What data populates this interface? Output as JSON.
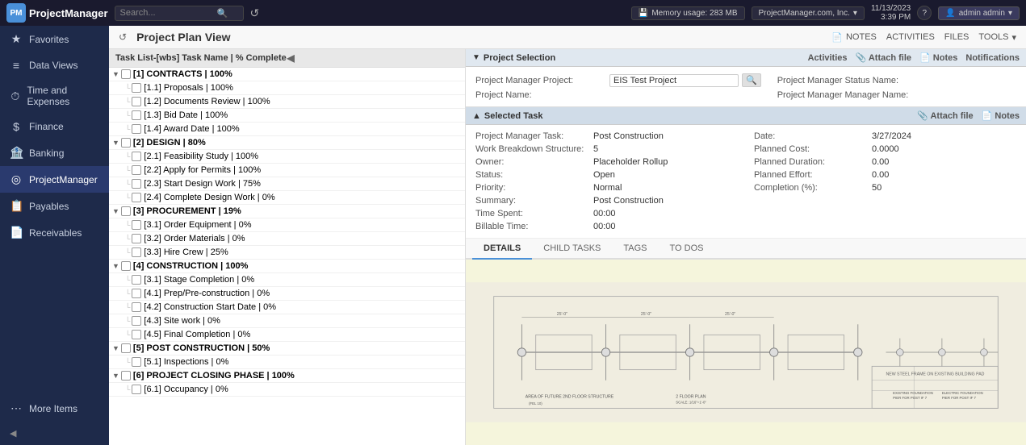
{
  "topNav": {
    "logo": "PM",
    "appName": "ProjectManager",
    "searchPlaceholder": "Search...",
    "memoryLabel": "Memory usage: 283 MB",
    "company": "ProjectManager.com, Inc.",
    "datetime": "11/13/2023\n3:39 PM",
    "user": "admin admin",
    "helpIcon": "?",
    "refreshIcon": "↺"
  },
  "sidebar": {
    "items": [
      {
        "id": "favorites",
        "icon": "★",
        "label": "Favorites"
      },
      {
        "id": "data-views",
        "icon": "≡",
        "label": "Data Views"
      },
      {
        "id": "time-expenses",
        "icon": "⏱",
        "label": "Time and Expenses"
      },
      {
        "id": "finance",
        "icon": "$",
        "label": "Finance"
      },
      {
        "id": "banking",
        "icon": "🏦",
        "label": "Banking"
      },
      {
        "id": "project-manager",
        "icon": "◎",
        "label": "ProjectManager"
      },
      {
        "id": "payables",
        "icon": "📋",
        "label": "Payables"
      },
      {
        "id": "receivables",
        "icon": "📄",
        "label": "Receivables"
      },
      {
        "id": "more-items",
        "icon": "⋯",
        "label": "More Items"
      }
    ],
    "activeItem": "project-manager"
  },
  "pageTitle": "Project Plan View",
  "subNavActions": [
    {
      "id": "notes",
      "icon": "📄",
      "label": "NOTES"
    },
    {
      "id": "activities",
      "label": "ACTIVITIES"
    },
    {
      "id": "files",
      "label": "FILES"
    },
    {
      "id": "tools",
      "label": "TOOLS ▾"
    }
  ],
  "taskPanel": {
    "header": "Task List-[wbs] Task Name | % Complete",
    "tasks": [
      {
        "id": "contracts",
        "level": 0,
        "label": "[1] CONTRACTS | 100%",
        "bold": true,
        "expanded": true
      },
      {
        "id": "proposals",
        "level": 1,
        "label": "[1.1] Proposals | 100%",
        "bold": false
      },
      {
        "id": "docs-review",
        "level": 1,
        "label": "[1.2] Documents Review | 100%",
        "bold": false
      },
      {
        "id": "bid-date",
        "level": 1,
        "label": "[1.3] Bid Date | 100%",
        "bold": false
      },
      {
        "id": "award-date",
        "level": 1,
        "label": "[1.4] Award Date | 100%",
        "bold": false
      },
      {
        "id": "design",
        "level": 0,
        "label": "[2] DESIGN | 80%",
        "bold": true,
        "expanded": true
      },
      {
        "id": "feasibility",
        "level": 1,
        "label": "[2.1] Feasibility Study | 100%",
        "bold": false
      },
      {
        "id": "permits",
        "level": 1,
        "label": "[2.2] Apply for Permits | 100%",
        "bold": false
      },
      {
        "id": "start-design",
        "level": 1,
        "label": "[2.3] Start Design Work | 75%",
        "bold": false
      },
      {
        "id": "complete-design",
        "level": 1,
        "label": "[2.4] Complete Design Work | 0%",
        "bold": false
      },
      {
        "id": "procurement",
        "level": 0,
        "label": "[3] PROCUREMENT | 19%",
        "bold": true,
        "expanded": true
      },
      {
        "id": "order-equip",
        "level": 1,
        "label": "[3.1] Order Equipment | 0%",
        "bold": false
      },
      {
        "id": "order-materials",
        "level": 1,
        "label": "[3.2] Order Materials | 0%",
        "bold": false
      },
      {
        "id": "hire-crew",
        "level": 1,
        "label": "[3.3] Hire Crew | 25%",
        "bold": false
      },
      {
        "id": "construction",
        "level": 0,
        "label": "[4] CONSTRUCTION | 100%",
        "bold": true,
        "expanded": true
      },
      {
        "id": "stage-completion",
        "level": 1,
        "label": "[3.1] Stage Completion | 0%",
        "bold": false
      },
      {
        "id": "prep-pre",
        "level": 1,
        "label": "[4.1] Prep/Pre-construction | 0%",
        "bold": false
      },
      {
        "id": "const-start",
        "level": 1,
        "label": "[4.2] Construction Start Date | 0%",
        "bold": false
      },
      {
        "id": "site-work",
        "level": 1,
        "label": "[4.3] Site work | 0%",
        "bold": false
      },
      {
        "id": "final-completion",
        "level": 1,
        "label": "[4.5] Final Completion | 0%",
        "bold": false
      },
      {
        "id": "post-construction",
        "level": 0,
        "label": "[5] POST CONSTRUCTION | 50%",
        "bold": true,
        "expanded": true
      },
      {
        "id": "inspections",
        "level": 1,
        "label": "[5.1] Inspections | 0%",
        "bold": false
      },
      {
        "id": "closing",
        "level": 0,
        "label": "[6] PROJECT CLOSING PHASE | 100%",
        "bold": true,
        "expanded": true
      },
      {
        "id": "occupancy",
        "level": 1,
        "label": "[6.1] Occupancy | 0%",
        "bold": false
      }
    ]
  },
  "projectSelection": {
    "sectionTitle": "Project Selection",
    "toggleIcon": "▼",
    "tools": [
      {
        "id": "activities-tool",
        "label": "Activities"
      },
      {
        "id": "attach-file-tool",
        "icon": "📎",
        "label": "Attach file"
      },
      {
        "id": "notes-tool",
        "icon": "📄",
        "label": "Notes"
      },
      {
        "id": "notifications-tool",
        "label": "Notifications"
      }
    ],
    "fields": {
      "projectManagerProject": {
        "label": "Project Manager Project:",
        "value": "EIS Test Project"
      },
      "statusName": {
        "label": "Project Manager Status Name:",
        "value": ""
      },
      "projectName": {
        "label": "Project Name:",
        "value": ""
      },
      "managerName": {
        "label": "Project Manager Manager Name:",
        "value": ""
      }
    }
  },
  "selectedTask": {
    "sectionTitle": "Selected Task",
    "toggleIcon": "▲",
    "tools": [
      {
        "id": "attach-file-tool2",
        "icon": "📎",
        "label": "Attach file"
      },
      {
        "id": "notes-tool2",
        "icon": "📄",
        "label": "Notes"
      }
    ],
    "fields": {
      "left": [
        {
          "label": "Project Manager Task:",
          "value": "Post Construction"
        },
        {
          "label": "Work Breakdown Structure:",
          "value": "5"
        },
        {
          "label": "Owner:",
          "value": "Placeholder Rollup"
        },
        {
          "label": "Status:",
          "value": "Open"
        },
        {
          "label": "Priority:",
          "value": "Normal"
        },
        {
          "label": "Summary:",
          "value": "Post Construction"
        },
        {
          "label": "Time Spent:",
          "value": "00:00"
        },
        {
          "label": "Billable Time:",
          "value": "00:00"
        }
      ],
      "right": [
        {
          "label": "Date:",
          "value": "3/27/2024"
        },
        {
          "label": "Planned Cost:",
          "value": "0.0000"
        },
        {
          "label": "Planned Duration:",
          "value": "0.00"
        },
        {
          "label": "Planned Effort:",
          "value": "0.00"
        },
        {
          "label": "Completion (%):",
          "value": "50"
        }
      ]
    }
  },
  "tabs": [
    {
      "id": "details",
      "label": "DETAILS",
      "active": true
    },
    {
      "id": "child-tasks",
      "label": "CHILD TASKS",
      "active": false
    },
    {
      "id": "tags",
      "label": "TAGS",
      "active": false
    },
    {
      "id": "to-dos",
      "label": "TO DOS",
      "active": false
    }
  ]
}
